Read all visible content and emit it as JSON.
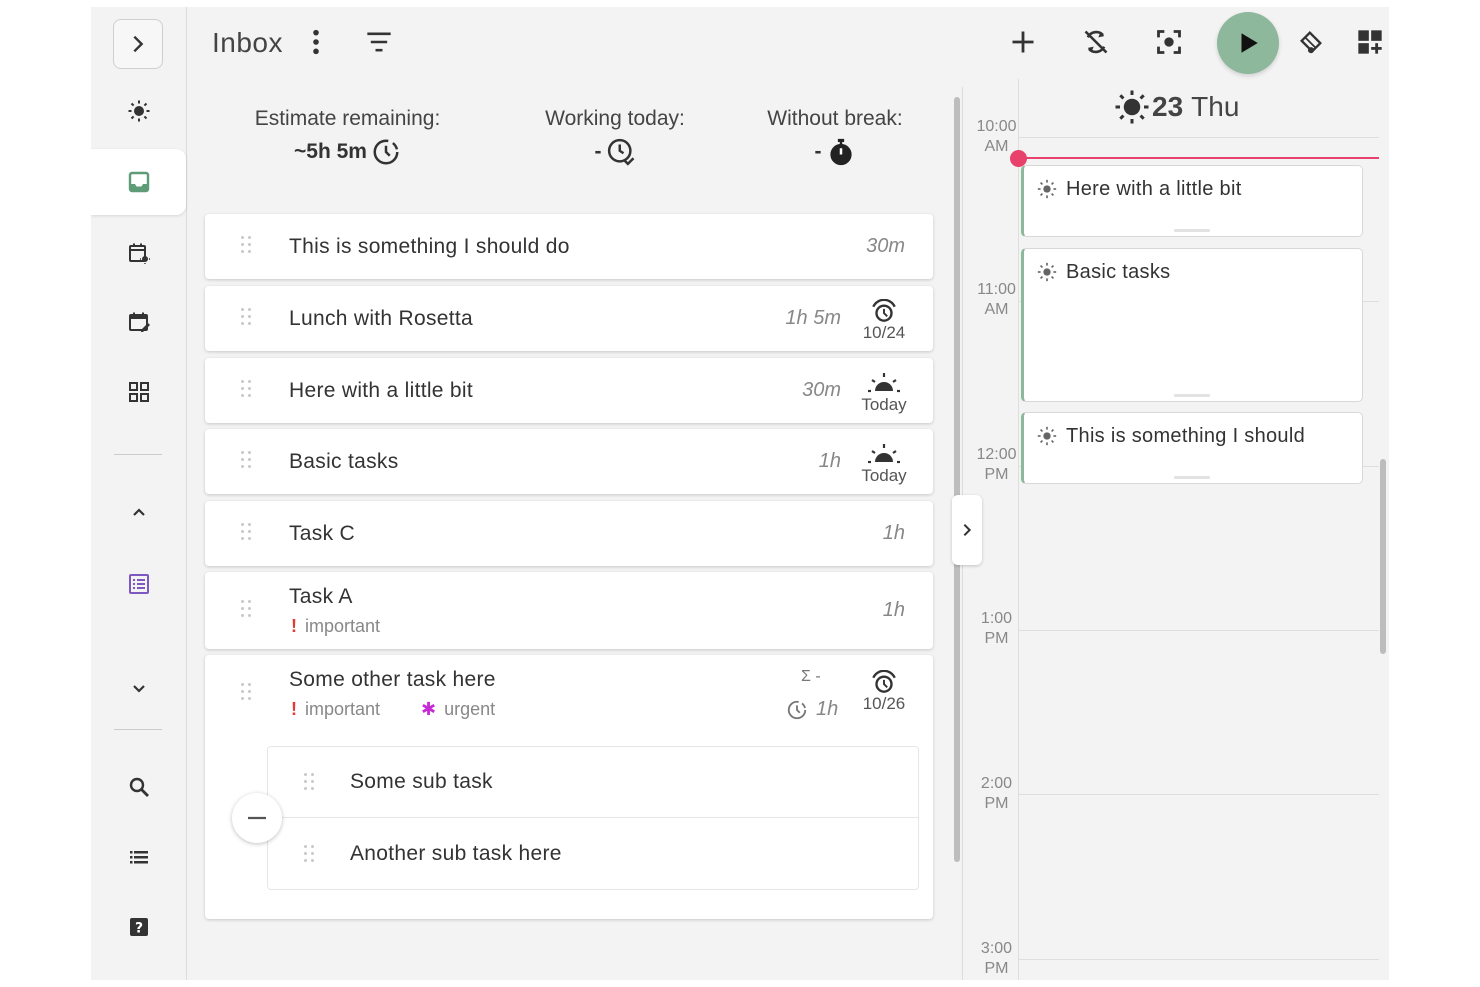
{
  "header": {
    "title": "Inbox",
    "icons": [
      "more-vertical-icon",
      "filter-icon",
      "add-icon",
      "sync-off-icon",
      "focus-mode-icon",
      "play-icon",
      "schedule-sun-icon",
      "add-widget-icon",
      "notes-icon"
    ]
  },
  "sidebar": {
    "items": [
      "expand-icon",
      "today-sun-icon",
      "inbox-icon",
      "planner-calendar-icon",
      "schedule-calendar-icon",
      "boards-icon",
      "collapse-up-icon",
      "project-list-icon",
      "collapse-down-icon",
      "search-icon",
      "list-icon",
      "help-icon"
    ]
  },
  "metrics": {
    "estimate_label": "Estimate remaining:",
    "estimate_value": "~5h 5m",
    "working_label": "Working today:",
    "working_value": "-",
    "break_label": "Without break:",
    "break_value": "-"
  },
  "tasks": [
    {
      "title": "This is something I should do",
      "estimate": "30m"
    },
    {
      "title": "Lunch with Rosetta",
      "estimate": "1h 5m",
      "badge": "10/24",
      "badge_icon": "alarm-icon"
    },
    {
      "title": "Here with a little bit",
      "estimate": "30m",
      "badge": "Today",
      "badge_icon": "sunrise-icon"
    },
    {
      "title": "Basic tasks",
      "estimate": "1h",
      "badge": "Today",
      "badge_icon": "sunrise-icon"
    },
    {
      "title": "Task C",
      "estimate": "1h"
    },
    {
      "title": "Task A",
      "estimate": "1h",
      "tags": [
        {
          "icon": "!",
          "label": "important"
        }
      ]
    },
    {
      "title": "Some other task here",
      "sum": "Σ -",
      "estimate": "1h",
      "badge": "10/26",
      "badge_icon": "alarm-icon",
      "tags": [
        {
          "icon": "!",
          "label": "important"
        },
        {
          "icon": "✱",
          "label": "urgent"
        }
      ],
      "subtasks": [
        {
          "title": "Some sub task"
        },
        {
          "title": "Another sub task here"
        }
      ]
    }
  ],
  "calendar": {
    "day_number": "23",
    "day_name": "Thu",
    "hours": [
      {
        "time": "10:00",
        "ampm": "AM"
      },
      {
        "time": "11:00",
        "ampm": "AM"
      },
      {
        "time": "12:00",
        "ampm": "PM"
      },
      {
        "time": "1:00",
        "ampm": "PM"
      },
      {
        "time": "2:00",
        "ampm": "PM"
      },
      {
        "time": "3:00",
        "ampm": "PM"
      }
    ],
    "events": [
      {
        "title": "Here with a little bit"
      },
      {
        "title": "Basic tasks"
      },
      {
        "title": "This is something I should"
      }
    ]
  },
  "colors": {
    "accent": "#8eb89c",
    "now_line": "#e8416b",
    "important": "#e53935",
    "urgent": "#c62ad6",
    "project": "#7e57c2"
  }
}
